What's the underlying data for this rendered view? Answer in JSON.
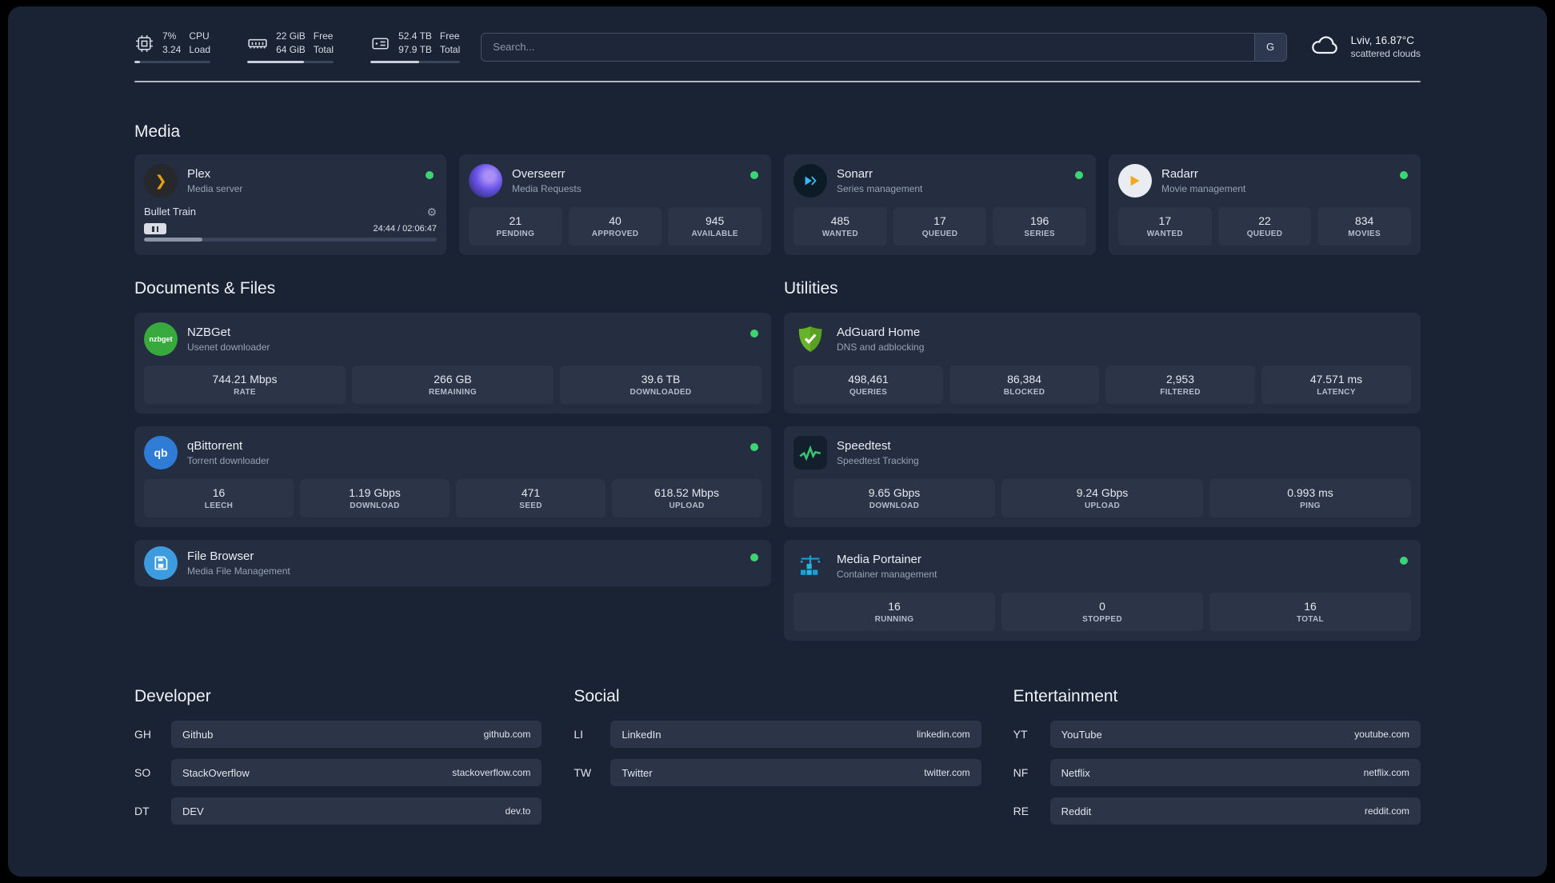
{
  "colors": {
    "status_online": "#3dd573",
    "accent_plex": "#e5a00d"
  },
  "topbar": {
    "cpu": {
      "percent": "7%",
      "load": "3.24",
      "label_top": "CPU",
      "label_bottom": "Load",
      "progress_pct": 7
    },
    "memory": {
      "free": "22 GiB",
      "total": "64 GiB",
      "label_top": "Free",
      "label_bottom": "Total",
      "progress_pct": 66
    },
    "storage": {
      "free": "52.4 TB",
      "total": "97.9 TB",
      "label_top": "Free",
      "label_bottom": "Total",
      "progress_pct": 54
    },
    "search": {
      "placeholder": "Search...",
      "engine_button": "G"
    },
    "weather": {
      "location": "Lviv, 16.87°C",
      "condition": "scattered clouds"
    }
  },
  "sections": {
    "media": "Media",
    "documents": "Documents & Files",
    "utilities": "Utilities",
    "developer": "Developer",
    "social": "Social",
    "entertainment": "Entertainment"
  },
  "services": {
    "plex": {
      "name": "Plex",
      "subtitle": "Media server",
      "player": {
        "title": "Bullet Train",
        "time": "24:44 / 02:06:47",
        "progress_pct": 20
      }
    },
    "overseerr": {
      "name": "Overseerr",
      "subtitle": "Media Requests",
      "stats": [
        {
          "value": "21",
          "label": "PENDING"
        },
        {
          "value": "40",
          "label": "APPROVED"
        },
        {
          "value": "945",
          "label": "AVAILABLE"
        }
      ]
    },
    "sonarr": {
      "name": "Sonarr",
      "subtitle": "Series management",
      "stats": [
        {
          "value": "485",
          "label": "WANTED"
        },
        {
          "value": "17",
          "label": "QUEUED"
        },
        {
          "value": "196",
          "label": "SERIES"
        }
      ]
    },
    "radarr": {
      "name": "Radarr",
      "subtitle": "Movie management",
      "stats": [
        {
          "value": "17",
          "label": "WANTED"
        },
        {
          "value": "22",
          "label": "QUEUED"
        },
        {
          "value": "834",
          "label": "MOVIES"
        }
      ]
    },
    "nzbget": {
      "name": "NZBGet",
      "subtitle": "Usenet downloader",
      "icon_text": "nzbget",
      "stats": [
        {
          "value": "744.21 Mbps",
          "label": "RATE"
        },
        {
          "value": "266 GB",
          "label": "REMAINING"
        },
        {
          "value": "39.6 TB",
          "label": "DOWNLOADED"
        }
      ]
    },
    "qbittorrent": {
      "name": "qBittorrent",
      "subtitle": "Torrent downloader",
      "icon_text": "qb",
      "stats": [
        {
          "value": "16",
          "label": "LEECH"
        },
        {
          "value": "1.19 Gbps",
          "label": "DOWNLOAD"
        },
        {
          "value": "471",
          "label": "SEED"
        },
        {
          "value": "618.52 Mbps",
          "label": "UPLOAD"
        }
      ]
    },
    "filebrowser": {
      "name": "File Browser",
      "subtitle": "Media File Management"
    },
    "adguard": {
      "name": "AdGuard Home",
      "subtitle": "DNS and adblocking",
      "stats": [
        {
          "value": "498,461",
          "label": "QUERIES"
        },
        {
          "value": "86,384",
          "label": "BLOCKED"
        },
        {
          "value": "2,953",
          "label": "FILTERED"
        },
        {
          "value": "47.571 ms",
          "label": "LATENCY"
        }
      ]
    },
    "speedtest": {
      "name": "Speedtest",
      "subtitle": "Speedtest Tracking",
      "stats": [
        {
          "value": "9.65 Gbps",
          "label": "DOWNLOAD"
        },
        {
          "value": "9.24 Gbps",
          "label": "UPLOAD"
        },
        {
          "value": "0.993 ms",
          "label": "PING"
        }
      ]
    },
    "portainer": {
      "name": "Media Portainer",
      "subtitle": "Container management",
      "stats": [
        {
          "value": "16",
          "label": "RUNNING"
        },
        {
          "value": "0",
          "label": "STOPPED"
        },
        {
          "value": "16",
          "label": "TOTAL"
        }
      ]
    }
  },
  "bookmarks": {
    "developer": [
      {
        "abbr": "GH",
        "name": "Github",
        "url": "github.com"
      },
      {
        "abbr": "SO",
        "name": "StackOverflow",
        "url": "stackoverflow.com"
      },
      {
        "abbr": "DT",
        "name": "DEV",
        "url": "dev.to"
      }
    ],
    "social": [
      {
        "abbr": "LI",
        "name": "LinkedIn",
        "url": "linkedin.com"
      },
      {
        "abbr": "TW",
        "name": "Twitter",
        "url": "twitter.com"
      }
    ],
    "entertainment": [
      {
        "abbr": "YT",
        "name": "YouTube",
        "url": "youtube.com"
      },
      {
        "abbr": "NF",
        "name": "Netflix",
        "url": "netflix.com"
      },
      {
        "abbr": "RE",
        "name": "Reddit",
        "url": "reddit.com"
      }
    ]
  }
}
